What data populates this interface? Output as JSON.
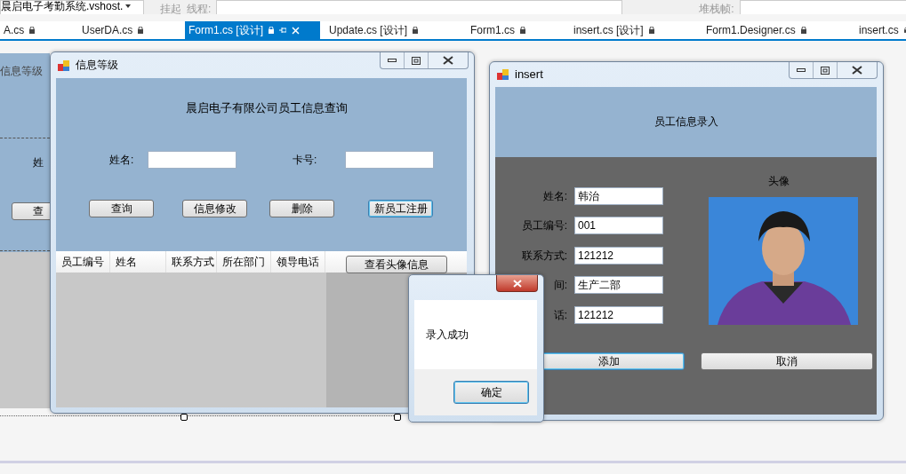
{
  "toolbar": {
    "process": "晨启电子考勤系统.vshost.",
    "suspend": "挂起",
    "thread_label": "线程:",
    "stack_label": "堆栈帧:"
  },
  "tabs": [
    {
      "label": "A.cs",
      "selected": false
    },
    {
      "label": "UserDA.cs",
      "selected": false
    },
    {
      "label": "Form1.cs [设计]",
      "selected": true
    },
    {
      "label": "Update.cs [设计]",
      "selected": false
    },
    {
      "label": "Form1.cs",
      "selected": false
    },
    {
      "label": "insert.cs [设计]",
      "selected": false
    },
    {
      "label": "Form1.Designer.cs",
      "selected": false
    },
    {
      "label": "insert.cs",
      "selected": false
    }
  ],
  "background_form": {
    "title": "信息等级",
    "name_label": "姓",
    "button": "查"
  },
  "main_form": {
    "title": "信息等级",
    "heading": "晨启电子有限公司员工信息查询",
    "fields": [
      {
        "label": "姓名:"
      },
      {
        "label": "卡号:"
      }
    ],
    "buttons": [
      {
        "label": "查询",
        "focused": false
      },
      {
        "label": "信息修改",
        "focused": false
      },
      {
        "label": "删除",
        "focused": false
      },
      {
        "label": "新员工注册",
        "focused": true
      }
    ],
    "grid": {
      "columns": [
        "员工编号",
        "姓名",
        "联系方式",
        "所在部门",
        "领导电话"
      ],
      "button": "查看头像信息"
    }
  },
  "insert_form": {
    "title": "insert",
    "heading": "员工信息录入",
    "fields": [
      {
        "label": "姓名:",
        "value": "韩治"
      },
      {
        "label": "员工编号:",
        "value": "001"
      },
      {
        "label": "联系方式:",
        "value": "121212"
      },
      {
        "label": "间:",
        "value": "生产二部"
      },
      {
        "label": "话:",
        "value": "121212"
      }
    ],
    "photo_label": "头像",
    "buttons": [
      {
        "label": "添加",
        "focused": true
      },
      {
        "label": "取消",
        "focused": false
      }
    ]
  },
  "message_box": {
    "message": "录入成功",
    "button": "确定"
  }
}
